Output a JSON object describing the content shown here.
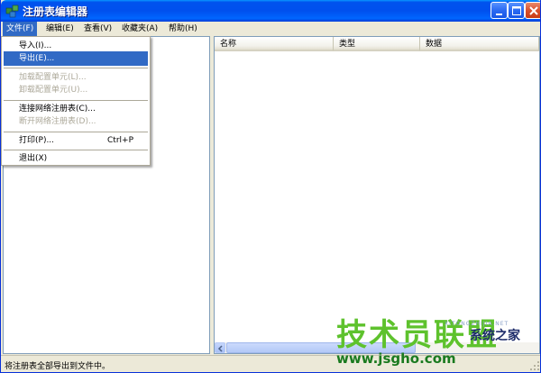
{
  "window": {
    "title": "注册表编辑器"
  },
  "menubar": [
    {
      "label": "文件(F)"
    },
    {
      "label": "编辑(E)"
    },
    {
      "label": "查看(V)"
    },
    {
      "label": "收藏夹(A)"
    },
    {
      "label": "帮助(H)"
    }
  ],
  "file_menu": {
    "items": [
      {
        "label": "导入(I)...",
        "enabled": true
      },
      {
        "label": "导出(E)...",
        "enabled": true,
        "highlighted": true
      },
      {
        "label": "加载配置单元(L)...",
        "enabled": false
      },
      {
        "label": "卸载配置单元(U)...",
        "enabled": false
      },
      {
        "label": "连接网络注册表(C)...",
        "enabled": true
      },
      {
        "label": "断开网络注册表(D)...",
        "enabled": false
      },
      {
        "label": "打印(P)...",
        "enabled": true,
        "shortcut": "Ctrl+P"
      },
      {
        "label": "退出(X)",
        "enabled": true
      }
    ]
  },
  "columns": [
    "名称",
    "类型",
    "数据"
  ],
  "statusbar": {
    "text": "将注册表全部导出到文件中。"
  },
  "watermark": {
    "main": "技术员联盟",
    "sub": "系统之家",
    "small": "XITONGZHIJIA.NET",
    "url": "www.jsgho.com"
  },
  "colors": {
    "titlebar": "#0050ee",
    "highlight": "#316ac5",
    "chrome": "#ece9d8",
    "watermark_green": "#5ec22d"
  }
}
